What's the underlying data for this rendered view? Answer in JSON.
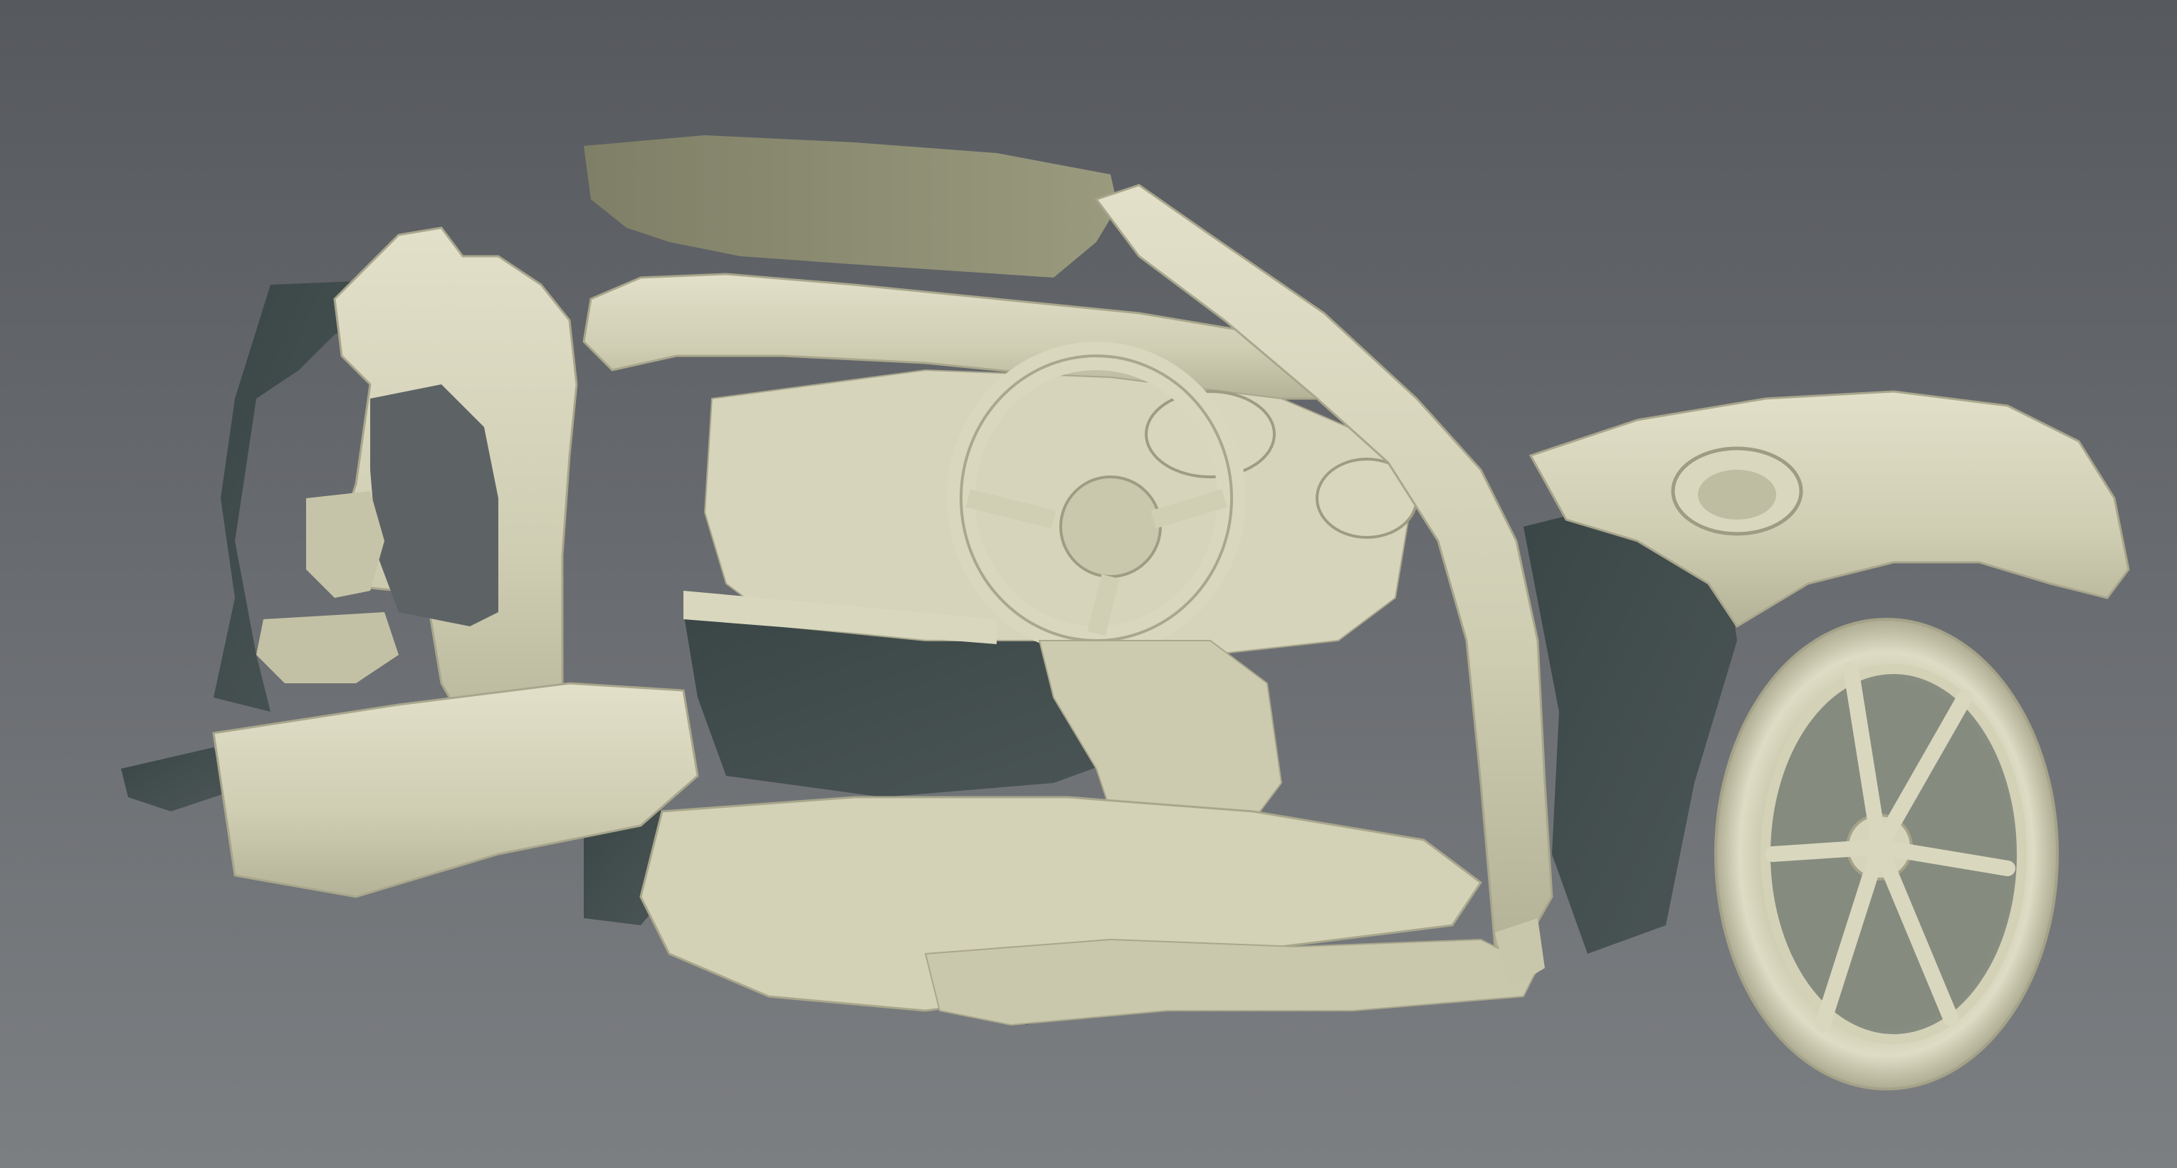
{
  "viewport": {
    "background_top": "#56595e",
    "background_bottom": "#7c7f82"
  },
  "model": {
    "surface_color": "#cfcdb2",
    "surface_light": "#e4e2cb",
    "surface_mid": "#bdbba0",
    "shadow_color": "#3f4a4a",
    "backface_color": "#8a8a70"
  }
}
